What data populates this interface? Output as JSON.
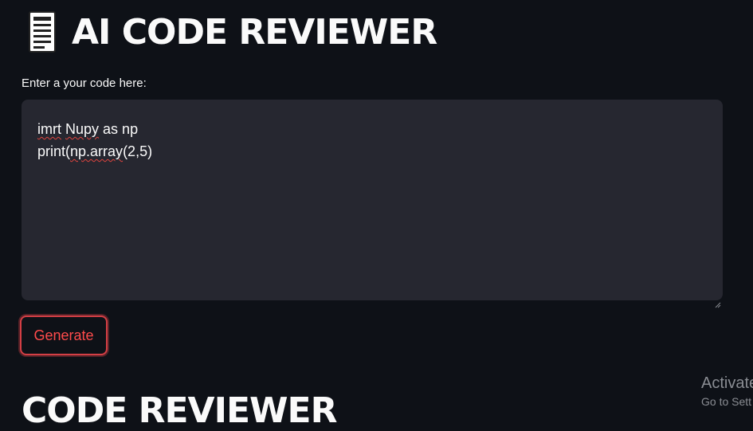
{
  "header": {
    "icon": "document-icon",
    "title": "AI CODE REVIEWER"
  },
  "code_input": {
    "label": "Enter a your code here:",
    "lines": [
      {
        "parts": [
          {
            "text": "imrt",
            "misspelled": true
          },
          {
            "text": " "
          },
          {
            "text": "Nupy",
            "misspelled": true
          },
          {
            "text": " as np"
          }
        ]
      },
      {
        "parts": [
          {
            "text": "print("
          },
          {
            "text": "np.array",
            "misspelled": true
          },
          {
            "text": "(2,5)"
          }
        ]
      }
    ]
  },
  "actions": {
    "generate_label": "Generate"
  },
  "output": {
    "heading": "CODE REVIEWER"
  },
  "watermark": {
    "line1": "Activate",
    "line2": "Go to Sett"
  },
  "colors": {
    "background": "#0e1117",
    "input_background": "#262730",
    "accent": "#ff4b4b",
    "spellcheck": "#e0443e"
  }
}
